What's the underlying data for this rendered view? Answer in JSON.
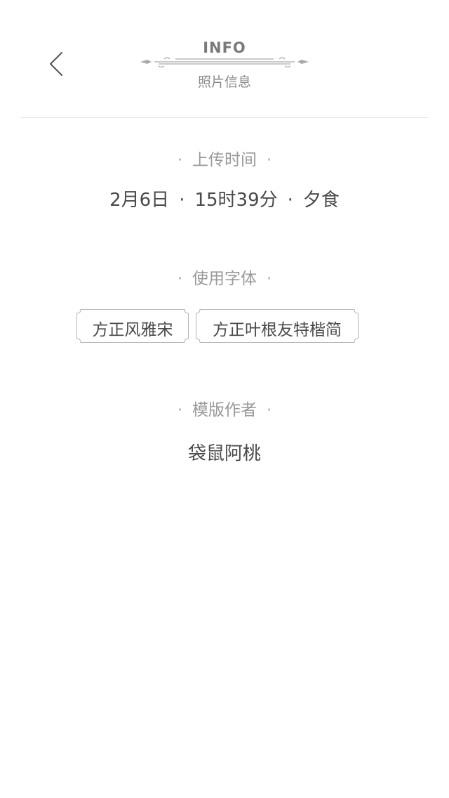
{
  "header": {
    "back_icon": "chevron-left-icon",
    "title_en": "INFO",
    "title_cn": "照片信息"
  },
  "upload_time": {
    "label": "上传时间",
    "date": "2月6日",
    "time": "15时39分",
    "meal": "夕食",
    "separator": "·"
  },
  "fonts": {
    "label": "使用字体",
    "items": [
      {
        "name": "方正风雅宋"
      },
      {
        "name": "方正叶根友特楷简"
      }
    ]
  },
  "author": {
    "label": "模版作者",
    "name": "袋鼠阿桃"
  },
  "decor_dot": "·",
  "colors": {
    "text_dark": "#4a4a4a",
    "text_light": "#9a9a9a",
    "divider": "#e4e4e4"
  }
}
